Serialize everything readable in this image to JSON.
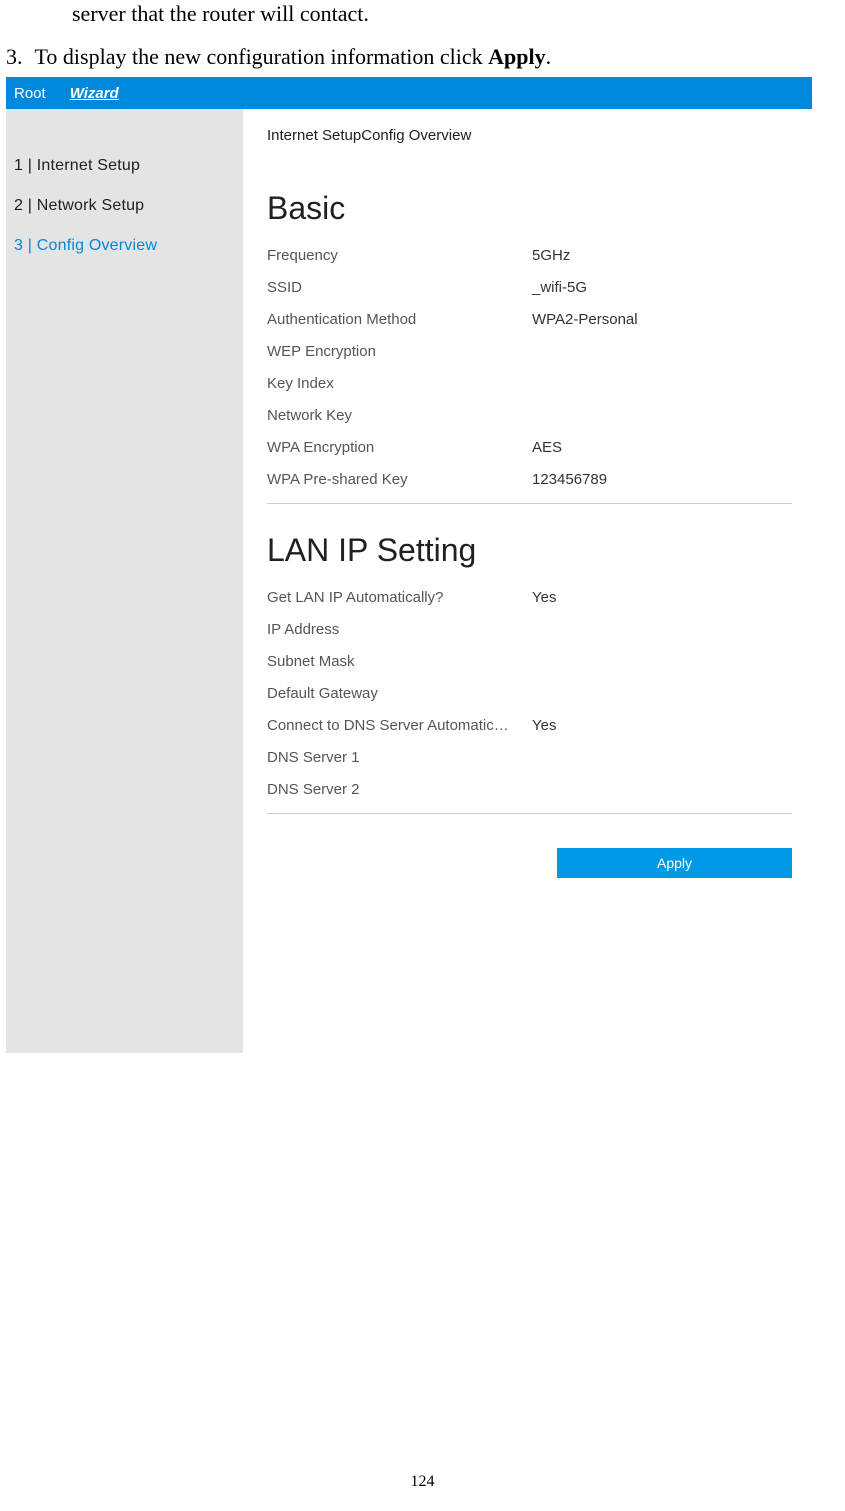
{
  "doc": {
    "fragment": "server that the router will contact.",
    "step_num": "3.",
    "step_text_a": "To display the new configuration information click ",
    "step_bold": "Apply",
    "step_text_b": ".",
    "page_number": "124"
  },
  "ui": {
    "topbar": {
      "root": "Root",
      "wizard": "Wizard"
    },
    "sidebar": {
      "item1": "1 | Internet Setup",
      "item2": "2 | Network Setup",
      "item3": "3 | Config Overview"
    },
    "breadcrumb": "Internet SetupConfig Overview",
    "basic": {
      "title": "Basic",
      "frequency_label": "Frequency",
      "frequency_value": "5GHz",
      "ssid_label": "SSID",
      "ssid_value": "_wifi-5G",
      "auth_label": "Authentication Method",
      "auth_value": "WPA2-Personal",
      "wep_label": "WEP Encryption",
      "wep_value": "",
      "keyindex_label": "Key Index",
      "keyindex_value": "",
      "netkey_label": "Network Key",
      "netkey_value": "",
      "wpaenc_label": "WPA Encryption",
      "wpaenc_value": "AES",
      "wpapsk_label": "WPA Pre-shared Key",
      "wpapsk_value": "123456789"
    },
    "lan": {
      "title": "LAN IP Setting",
      "getauto_label": "Get LAN IP Automatically?",
      "getauto_value": "Yes",
      "ip_label": "IP Address",
      "ip_value": "",
      "subnet_label": "Subnet Mask",
      "subnet_value": "",
      "gateway_label": "Default Gateway",
      "gateway_value": "",
      "dnsauto_label": "Connect to DNS Server Automatic…",
      "dnsauto_value": "Yes",
      "dns1_label": "DNS Server 1",
      "dns1_value": "",
      "dns2_label": "DNS Server 2",
      "dns2_value": ""
    },
    "apply_label": "Apply"
  }
}
